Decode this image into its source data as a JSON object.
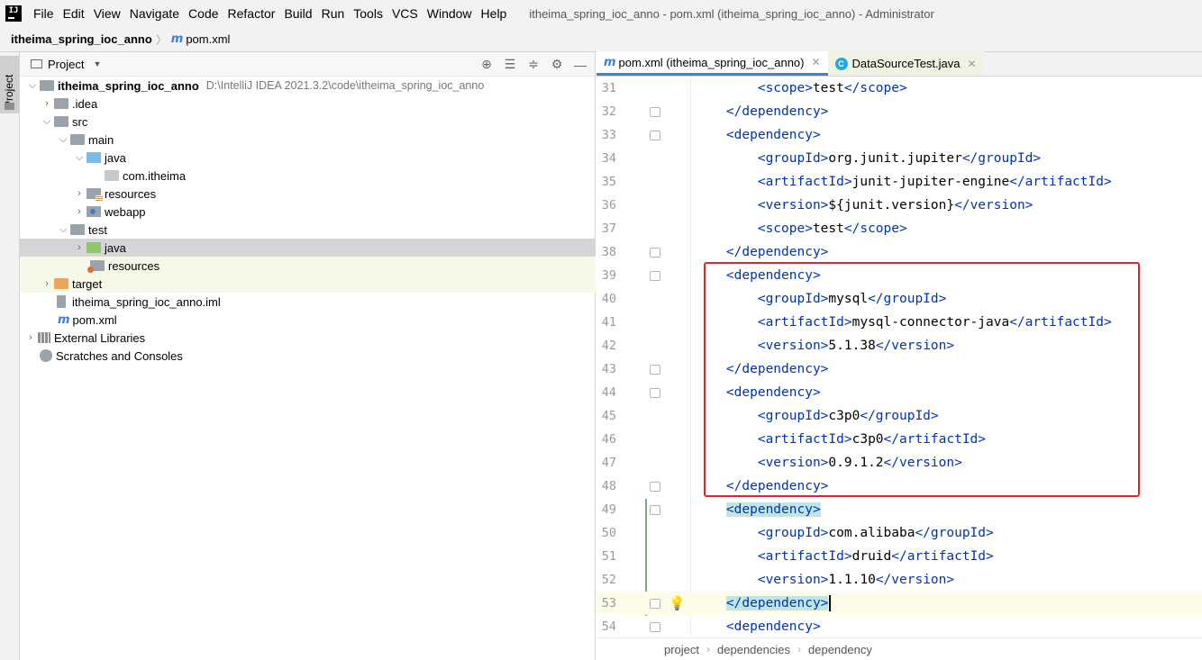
{
  "menu": {
    "items": [
      "File",
      "Edit",
      "View",
      "Navigate",
      "Code",
      "Refactor",
      "Build",
      "Run",
      "Tools",
      "VCS",
      "Window",
      "Help"
    ],
    "window_title": "itheima_spring_ioc_anno - pom.xml (itheima_spring_ioc_anno) - Administrator"
  },
  "navbar": {
    "project": "itheima_spring_ioc_anno",
    "file": "pom.xml"
  },
  "left_strip": {
    "label": "Project"
  },
  "project_panel": {
    "title": "Project",
    "tree": [
      {
        "label": "itheima_spring_ioc_anno",
        "path": "D:\\IntelliJ IDEA 2021.3.2\\code\\itheima_spring_ioc_anno"
      },
      {
        "label": ".idea"
      },
      {
        "label": "src"
      },
      {
        "label": "main"
      },
      {
        "label": "java"
      },
      {
        "label": "com.itheima"
      },
      {
        "label": "resources"
      },
      {
        "label": "webapp"
      },
      {
        "label": "test"
      },
      {
        "label": "java"
      },
      {
        "label": "resources"
      },
      {
        "label": "target"
      },
      {
        "label": "itheima_spring_ioc_anno.iml"
      },
      {
        "label": "pom.xml"
      },
      {
        "label": "External Libraries"
      },
      {
        "label": "Scratches and Consoles"
      }
    ]
  },
  "editor": {
    "tabs": [
      {
        "label": "pom.xml (itheima_spring_ioc_anno)",
        "active": true
      },
      {
        "label": "DataSourceTest.java",
        "active": false
      }
    ],
    "lines": [
      {
        "num": "31",
        "text": "        <scope>test</scope>"
      },
      {
        "num": "32",
        "text": "    </dependency>"
      },
      {
        "num": "33",
        "text": "    <dependency>"
      },
      {
        "num": "34",
        "text": "        <groupId>org.junit.jupiter</groupId>"
      },
      {
        "num": "35",
        "text": "        <artifactId>junit-jupiter-engine</artifactId>"
      },
      {
        "num": "36",
        "text": "        <version>${junit.version}</version>"
      },
      {
        "num": "37",
        "text": "        <scope>test</scope>"
      },
      {
        "num": "38",
        "text": "    </dependency>"
      },
      {
        "num": "39",
        "text": "    <dependency>"
      },
      {
        "num": "40",
        "text": "        <groupId>mysql</groupId>"
      },
      {
        "num": "41",
        "text": "        <artifactId>mysql-connector-java</artifactId>"
      },
      {
        "num": "42",
        "text": "        <version>5.1.38</version>"
      },
      {
        "num": "43",
        "text": "    </dependency>"
      },
      {
        "num": "44",
        "text": "    <dependency>"
      },
      {
        "num": "45",
        "text": "        <groupId>c3p0</groupId>"
      },
      {
        "num": "46",
        "text": "        <artifactId>c3p0</artifactId>"
      },
      {
        "num": "47",
        "text": "        <version>0.9.1.2</version>"
      },
      {
        "num": "48",
        "text": "    </dependency>"
      },
      {
        "num": "49",
        "text": "    <dependency>"
      },
      {
        "num": "50",
        "text": "        <groupId>com.alibaba</groupId>"
      },
      {
        "num": "51",
        "text": "        <artifactId>druid</artifactId>"
      },
      {
        "num": "52",
        "text": "        <version>1.1.10</version>"
      },
      {
        "num": "53",
        "text": "    </dependency>"
      },
      {
        "num": "54",
        "text": "    <dependency>"
      }
    ],
    "breadcrumb": [
      "project",
      "dependencies",
      "dependency"
    ]
  },
  "colors": {
    "tag": "#0033b3",
    "highlight_box": "#e8212c",
    "selection": "#d5d5d5",
    "accent": "#4083c9"
  }
}
